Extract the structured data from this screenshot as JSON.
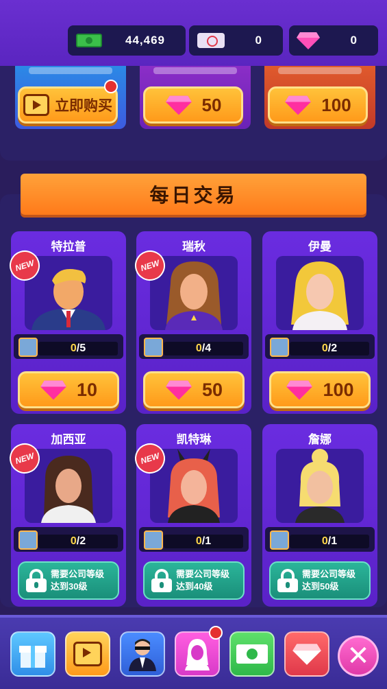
{
  "currency": {
    "cash": "44,469",
    "tickets": "0",
    "gems": "0"
  },
  "shop": {
    "buy_now_label": "立即购买",
    "price_2": "50",
    "price_3": "100"
  },
  "banner_title": "每日交易",
  "new_label": "NEW",
  "characters": [
    {
      "name": "特拉普",
      "count": "0",
      "total": "/5",
      "price": "10"
    },
    {
      "name": "瑞秋",
      "count": "0",
      "total": "/4",
      "price": "50"
    },
    {
      "name": "伊曼",
      "count": "0",
      "total": "/2",
      "price": "100"
    },
    {
      "name": "加西亚",
      "count": "0",
      "total": "/2",
      "lock_line1": "需要公司等级",
      "lock_line2": "达到30级"
    },
    {
      "name": "凯特琳",
      "count": "0",
      "total": "/1",
      "lock_line1": "需要公司等级",
      "lock_line2": "达到40级"
    },
    {
      "name": "詹娜",
      "count": "0",
      "total": "/1",
      "lock_line1": "需要公司等级",
      "lock_line2": "达到50级"
    }
  ],
  "nav_icons": [
    "gift-icon",
    "tv-icon",
    "manager-icon",
    "character-icon",
    "cash-icon",
    "gem-icon",
    "close-icon"
  ],
  "colors": {
    "accent_orange": "#ff9a1a",
    "panel": "#2b2166",
    "card": "#5a22c8",
    "lock_green": "#1a8f7a"
  }
}
